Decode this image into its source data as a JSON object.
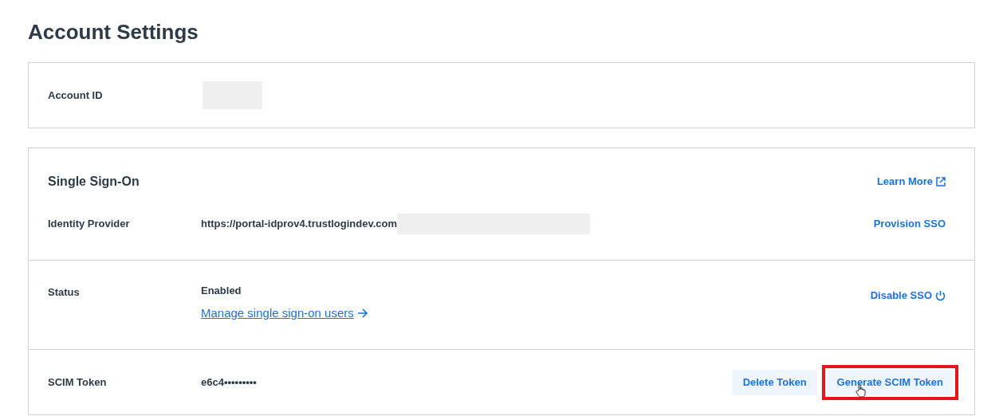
{
  "title": "Account Settings",
  "account": {
    "label": "Account ID"
  },
  "sso": {
    "title": "Single Sign-On",
    "learn_more": "Learn More",
    "identity_provider": {
      "label": "Identity Provider",
      "value": "https://portal-idprov4.trustlogindev.com",
      "action": "Provision SSO"
    },
    "status": {
      "label": "Status",
      "value": "Enabled",
      "link": "Manage single sign-on users",
      "action": "Disable SSO"
    },
    "scim": {
      "label": "SCIM Token",
      "value": "e6c4•••••••••",
      "buttons": [
        {
          "label": "Delete Token",
          "highlighted": false
        },
        {
          "label": "Generate SCIM Token",
          "highlighted": true
        }
      ]
    }
  }
}
